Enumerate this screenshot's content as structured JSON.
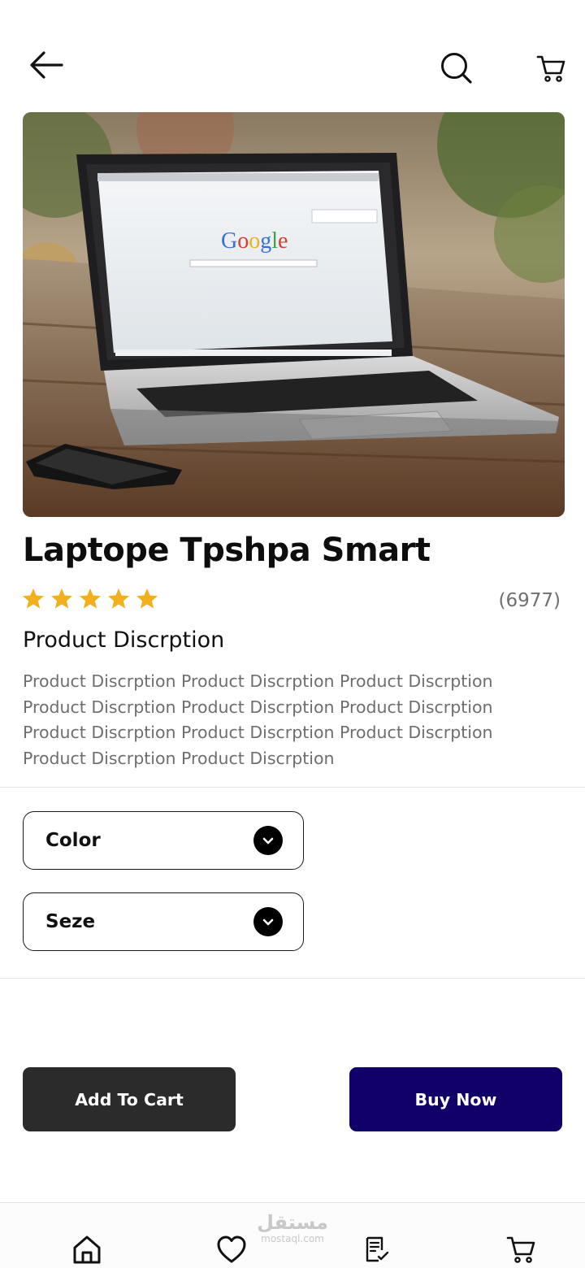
{
  "header": {
    "back_icon": "arrow-left-icon",
    "search_icon": "search-icon",
    "cart_icon": "cart-icon"
  },
  "product": {
    "image_alt": "laptop-photo",
    "title": "Laptope Tpshpa Smart",
    "rating": 5,
    "rating_max": 5,
    "rating_count": "(6977)",
    "star_color": "#F2B01E",
    "description_heading": "Product Discrption",
    "description_body": "Product Discrption Product Discrption Product Discrption Product Discrption Product Discrption Product Discrption Product Discrption Product Discrption Product Discrption Product Discrption Product Discrption"
  },
  "options": {
    "color_label": "Color",
    "size_label": "Seze"
  },
  "actions": {
    "add_to_cart": "Add To Cart",
    "buy_now": "Buy Now",
    "add_to_cart_color": "#2B2B2B",
    "buy_now_color": "#100068"
  },
  "bottom_nav": {
    "items": [
      "home-icon",
      "heart-icon",
      "orders-icon",
      "cart-icon"
    ]
  },
  "watermark": {
    "arabic": "مستقل",
    "latin": "mostaql.com"
  }
}
